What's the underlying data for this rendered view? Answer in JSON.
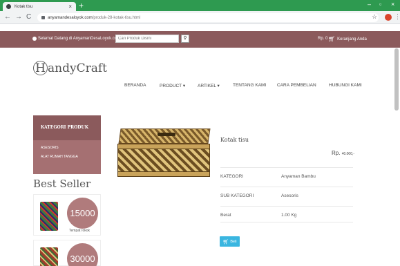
{
  "browser": {
    "tab_title": "Kotak tisu",
    "tab_close": "×",
    "new_tab": "+",
    "url_domain": "anyamandesaloyok.com",
    "url_path": "/produk-28-kotak-tisu.html",
    "minimize": "–",
    "maximize": "▫",
    "close": "×"
  },
  "topbar": {
    "welcome": "Selamat Datang di AnyamanDesaLoyok.com",
    "search_placeholder": "Cari Produk Disini",
    "account": "Rp. 0",
    "cart": "Keranjang Anda"
  },
  "logo": {
    "first_letter": "H",
    "rest": "andyCraft"
  },
  "nav": [
    "BERANDA",
    "PRODUCT ▾",
    "ARTIKEL ▾",
    "TENTANG KAMI",
    "CARA PEMBELIAN",
    "HUBUNGI KAMI"
  ],
  "sidebar": {
    "header": "KATEGORI PRODUK",
    "items": [
      "ASESORIS",
      "ALAT RUMAH TANGGA"
    ],
    "best_seller_title": "Best Seller",
    "best_sellers": [
      {
        "price": "15000",
        "name": "Tempat rokok"
      },
      {
        "price": "30000",
        "name": ""
      }
    ]
  },
  "product": {
    "title": "Kotak tisu",
    "price_prefix": "Rp.",
    "price_value": "40.000,-",
    "details": [
      {
        "key": "KATEGORI",
        "value": "Anyaman Bambu"
      },
      {
        "key": "SUB KATEGORI",
        "value": "Asesoris"
      },
      {
        "key": "Berat",
        "value": "1.00 Kg"
      }
    ],
    "buy_label": "Beli"
  },
  "colors": {
    "brand": "#8b5a5c",
    "chrome": "#2e9a50",
    "button": "#3ab6e0"
  }
}
